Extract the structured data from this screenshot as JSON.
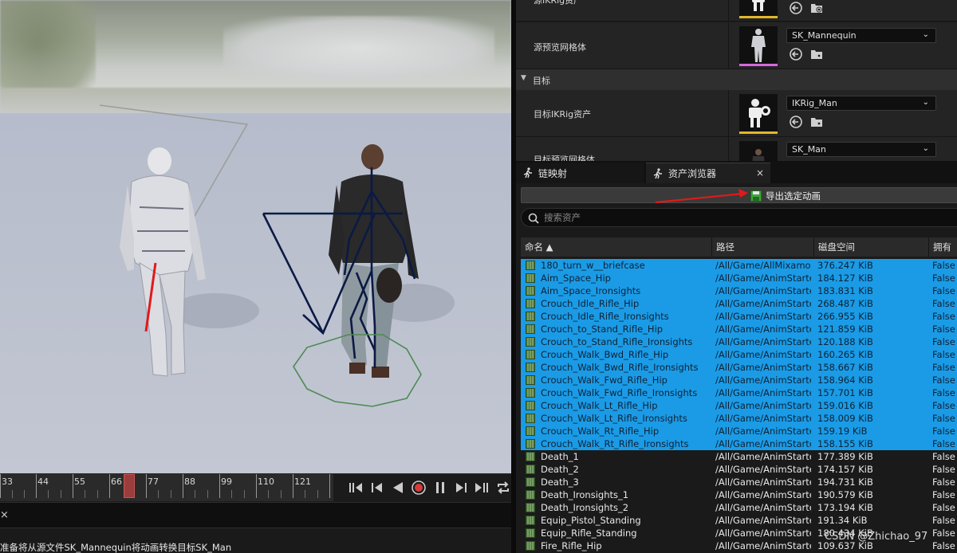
{
  "timeline": {
    "ticks": [
      "33",
      "44",
      "55",
      "66",
      "77",
      "88",
      "99",
      "110",
      "121"
    ],
    "transport": [
      "skip-start-icon",
      "step-back-icon",
      "play-reverse-icon",
      "record-icon",
      "pause-icon",
      "step-forward-icon",
      "skip-end-icon",
      "loop-icon"
    ]
  },
  "status": {
    "close": "×",
    "text": "准备将从源文件SK_Mannequin将动画转换目标SK_Man"
  },
  "details": {
    "row_top_label": "源IKRig资产",
    "source_preview": {
      "label": "源预览网格体",
      "value": "SK_Mannequin"
    },
    "section_target": "目标",
    "target_ikrig": {
      "label": "目标IKRig资产",
      "value": "IKRig_Man"
    },
    "target_preview": {
      "label": "目标预览网格体",
      "value": "SK_Man"
    }
  },
  "tabs": {
    "retarget": "链映射",
    "browser": "资产浏览器",
    "close": "×"
  },
  "browser": {
    "export_label": "导出选定动画",
    "search_placeholder": "搜索资产",
    "columns": {
      "name": "命名 ▲",
      "path": "路径",
      "disk": "磁盘空间",
      "owner": "拥有"
    },
    "rows": [
      {
        "name": "180_turn_w__briefcase",
        "path": "/All/Game/AllMixamo",
        "disk": "376.247 KiB",
        "own": "False",
        "sel": true
      },
      {
        "name": "Aim_Space_Hip",
        "path": "/All/Game/AnimStarterPack",
        "disk": "184.127 KiB",
        "own": "False",
        "sel": true
      },
      {
        "name": "Aim_Space_Ironsights",
        "path": "/All/Game/AnimStarterPack",
        "disk": "183.831 KiB",
        "own": "False",
        "sel": true
      },
      {
        "name": "Crouch_Idle_Rifle_Hip",
        "path": "/All/Game/AnimStarterPack",
        "disk": "268.487 KiB",
        "own": "False",
        "sel": true
      },
      {
        "name": "Crouch_Idle_Rifle_Ironsights",
        "path": "/All/Game/AnimStarterPack",
        "disk": "266.955 KiB",
        "own": "False",
        "sel": true
      },
      {
        "name": "Crouch_to_Stand_Rifle_Hip",
        "path": "/All/Game/AnimStarterPack",
        "disk": "121.859 KiB",
        "own": "False",
        "sel": true
      },
      {
        "name": "Crouch_to_Stand_Rifle_Ironsights",
        "path": "/All/Game/AnimStarterPack",
        "disk": "120.188 KiB",
        "own": "False",
        "sel": true
      },
      {
        "name": "Crouch_Walk_Bwd_Rifle_Hip",
        "path": "/All/Game/AnimStarterPack",
        "disk": "160.265 KiB",
        "own": "False",
        "sel": true
      },
      {
        "name": "Crouch_Walk_Bwd_Rifle_Ironsights",
        "path": "/All/Game/AnimStarterPack",
        "disk": "158.667 KiB",
        "own": "False",
        "sel": true
      },
      {
        "name": "Crouch_Walk_Fwd_Rifle_Hip",
        "path": "/All/Game/AnimStarterPack",
        "disk": "158.964 KiB",
        "own": "False",
        "sel": true
      },
      {
        "name": "Crouch_Walk_Fwd_Rifle_Ironsights",
        "path": "/All/Game/AnimStarterPack",
        "disk": "157.701 KiB",
        "own": "False",
        "sel": true
      },
      {
        "name": "Crouch_Walk_Lt_Rifle_Hip",
        "path": "/All/Game/AnimStarterPack",
        "disk": "159.016 KiB",
        "own": "False",
        "sel": true
      },
      {
        "name": "Crouch_Walk_Lt_Rifle_Ironsights",
        "path": "/All/Game/AnimStarterPack",
        "disk": "158.009 KiB",
        "own": "False",
        "sel": true
      },
      {
        "name": "Crouch_Walk_Rt_Rifle_Hip",
        "path": "/All/Game/AnimStarterPack",
        "disk": "159.19 KiB",
        "own": "False",
        "sel": true
      },
      {
        "name": "Crouch_Walk_Rt_Rifle_Ironsights",
        "path": "/All/Game/AnimStarterPack",
        "disk": "158.155 KiB",
        "own": "False",
        "sel": true
      },
      {
        "name": "Death_1",
        "path": "/All/Game/AnimStarterPack",
        "disk": "177.389 KiB",
        "own": "False",
        "sel": false
      },
      {
        "name": "Death_2",
        "path": "/All/Game/AnimStarterPack",
        "disk": "174.157 KiB",
        "own": "False",
        "sel": false
      },
      {
        "name": "Death_3",
        "path": "/All/Game/AnimStarterPack",
        "disk": "194.731 KiB",
        "own": "False",
        "sel": false
      },
      {
        "name": "Death_Ironsights_1",
        "path": "/All/Game/AnimStarterPack",
        "disk": "190.579 KiB",
        "own": "False",
        "sel": false
      },
      {
        "name": "Death_Ironsights_2",
        "path": "/All/Game/AnimStarterPack",
        "disk": "173.194 KiB",
        "own": "False",
        "sel": false
      },
      {
        "name": "Equip_Pistol_Standing",
        "path": "/All/Game/AnimStarterPack",
        "disk": "191.34 KiB",
        "own": "False",
        "sel": false
      },
      {
        "name": "Equip_Rifle_Standing",
        "path": "/All/Game/AnimStarterPack",
        "disk": "180.434 KiB",
        "own": "False",
        "sel": false
      },
      {
        "name": "Fire_Rifle_Hip",
        "path": "/All/Game/AnimStarterPack",
        "disk": "109.637 KiB",
        "own": "False",
        "sel": false
      }
    ]
  },
  "watermark": "CSDN @Zhichao_97",
  "colors": {
    "selection": "#1b9be6",
    "accent_yellow": "#e2b72a",
    "accent_pink": "#d66ad9",
    "playhead": "#9b3d3d"
  }
}
